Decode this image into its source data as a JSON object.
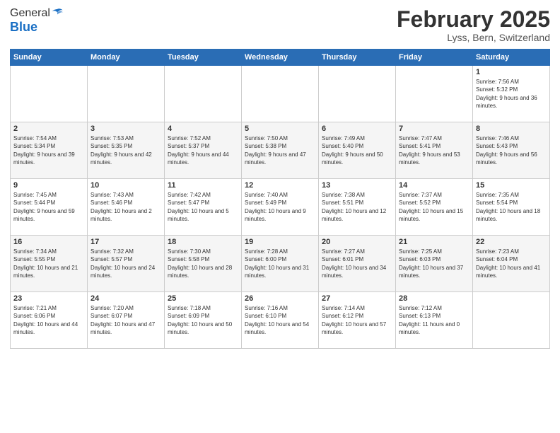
{
  "header": {
    "logo_general": "General",
    "logo_blue": "Blue",
    "month_title": "February 2025",
    "location": "Lyss, Bern, Switzerland"
  },
  "weekdays": [
    "Sunday",
    "Monday",
    "Tuesday",
    "Wednesday",
    "Thursday",
    "Friday",
    "Saturday"
  ],
  "weeks": [
    [
      {
        "day": "",
        "info": ""
      },
      {
        "day": "",
        "info": ""
      },
      {
        "day": "",
        "info": ""
      },
      {
        "day": "",
        "info": ""
      },
      {
        "day": "",
        "info": ""
      },
      {
        "day": "",
        "info": ""
      },
      {
        "day": "1",
        "info": "Sunrise: 7:56 AM\nSunset: 5:32 PM\nDaylight: 9 hours and 36 minutes."
      }
    ],
    [
      {
        "day": "2",
        "info": "Sunrise: 7:54 AM\nSunset: 5:34 PM\nDaylight: 9 hours and 39 minutes."
      },
      {
        "day": "3",
        "info": "Sunrise: 7:53 AM\nSunset: 5:35 PM\nDaylight: 9 hours and 42 minutes."
      },
      {
        "day": "4",
        "info": "Sunrise: 7:52 AM\nSunset: 5:37 PM\nDaylight: 9 hours and 44 minutes."
      },
      {
        "day": "5",
        "info": "Sunrise: 7:50 AM\nSunset: 5:38 PM\nDaylight: 9 hours and 47 minutes."
      },
      {
        "day": "6",
        "info": "Sunrise: 7:49 AM\nSunset: 5:40 PM\nDaylight: 9 hours and 50 minutes."
      },
      {
        "day": "7",
        "info": "Sunrise: 7:47 AM\nSunset: 5:41 PM\nDaylight: 9 hours and 53 minutes."
      },
      {
        "day": "8",
        "info": "Sunrise: 7:46 AM\nSunset: 5:43 PM\nDaylight: 9 hours and 56 minutes."
      }
    ],
    [
      {
        "day": "9",
        "info": "Sunrise: 7:45 AM\nSunset: 5:44 PM\nDaylight: 9 hours and 59 minutes."
      },
      {
        "day": "10",
        "info": "Sunrise: 7:43 AM\nSunset: 5:46 PM\nDaylight: 10 hours and 2 minutes."
      },
      {
        "day": "11",
        "info": "Sunrise: 7:42 AM\nSunset: 5:47 PM\nDaylight: 10 hours and 5 minutes."
      },
      {
        "day": "12",
        "info": "Sunrise: 7:40 AM\nSunset: 5:49 PM\nDaylight: 10 hours and 9 minutes."
      },
      {
        "day": "13",
        "info": "Sunrise: 7:38 AM\nSunset: 5:51 PM\nDaylight: 10 hours and 12 minutes."
      },
      {
        "day": "14",
        "info": "Sunrise: 7:37 AM\nSunset: 5:52 PM\nDaylight: 10 hours and 15 minutes."
      },
      {
        "day": "15",
        "info": "Sunrise: 7:35 AM\nSunset: 5:54 PM\nDaylight: 10 hours and 18 minutes."
      }
    ],
    [
      {
        "day": "16",
        "info": "Sunrise: 7:34 AM\nSunset: 5:55 PM\nDaylight: 10 hours and 21 minutes."
      },
      {
        "day": "17",
        "info": "Sunrise: 7:32 AM\nSunset: 5:57 PM\nDaylight: 10 hours and 24 minutes."
      },
      {
        "day": "18",
        "info": "Sunrise: 7:30 AM\nSunset: 5:58 PM\nDaylight: 10 hours and 28 minutes."
      },
      {
        "day": "19",
        "info": "Sunrise: 7:28 AM\nSunset: 6:00 PM\nDaylight: 10 hours and 31 minutes."
      },
      {
        "day": "20",
        "info": "Sunrise: 7:27 AM\nSunset: 6:01 PM\nDaylight: 10 hours and 34 minutes."
      },
      {
        "day": "21",
        "info": "Sunrise: 7:25 AM\nSunset: 6:03 PM\nDaylight: 10 hours and 37 minutes."
      },
      {
        "day": "22",
        "info": "Sunrise: 7:23 AM\nSunset: 6:04 PM\nDaylight: 10 hours and 41 minutes."
      }
    ],
    [
      {
        "day": "23",
        "info": "Sunrise: 7:21 AM\nSunset: 6:06 PM\nDaylight: 10 hours and 44 minutes."
      },
      {
        "day": "24",
        "info": "Sunrise: 7:20 AM\nSunset: 6:07 PM\nDaylight: 10 hours and 47 minutes."
      },
      {
        "day": "25",
        "info": "Sunrise: 7:18 AM\nSunset: 6:09 PM\nDaylight: 10 hours and 50 minutes."
      },
      {
        "day": "26",
        "info": "Sunrise: 7:16 AM\nSunset: 6:10 PM\nDaylight: 10 hours and 54 minutes."
      },
      {
        "day": "27",
        "info": "Sunrise: 7:14 AM\nSunset: 6:12 PM\nDaylight: 10 hours and 57 minutes."
      },
      {
        "day": "28",
        "info": "Sunrise: 7:12 AM\nSunset: 6:13 PM\nDaylight: 11 hours and 0 minutes."
      },
      {
        "day": "",
        "info": ""
      }
    ]
  ]
}
